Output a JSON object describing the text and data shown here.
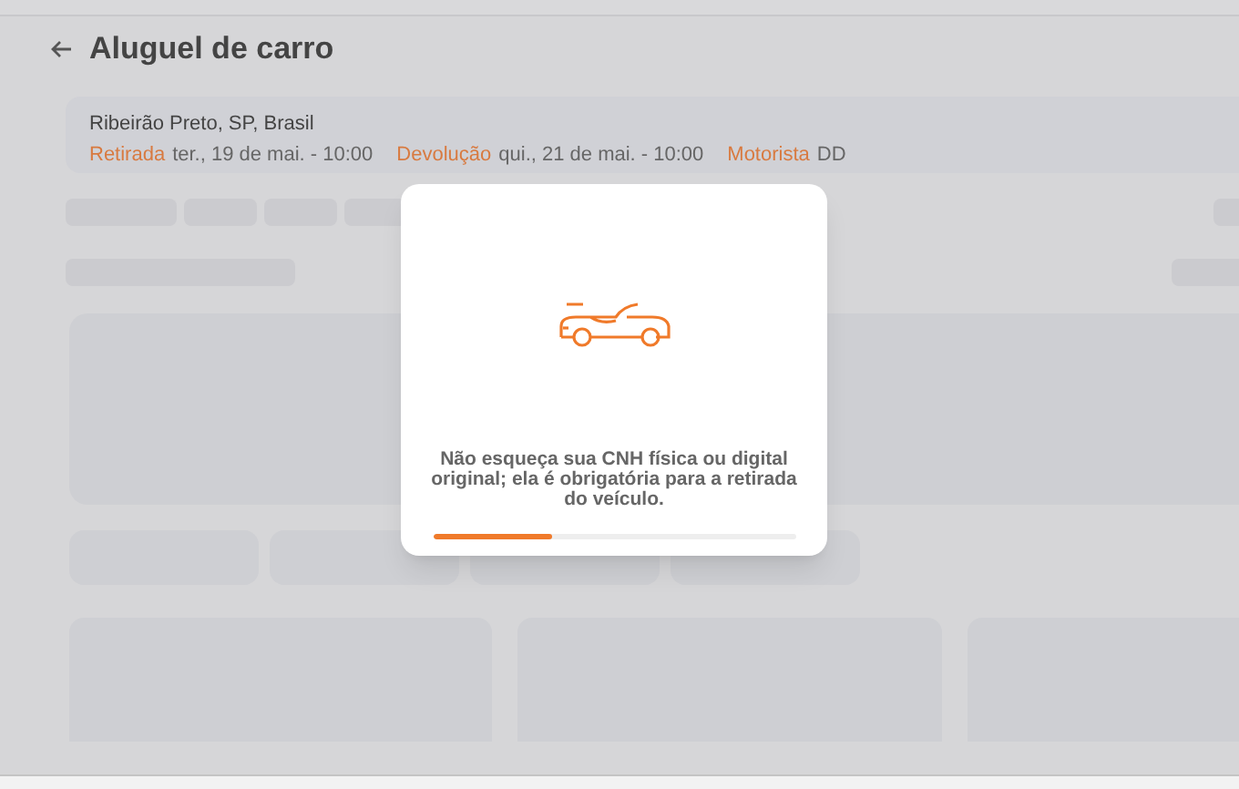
{
  "header": {
    "title": "Aluguel de carro"
  },
  "trip": {
    "location": "Ribeirão Preto, SP, Brasil",
    "fields": [
      {
        "label": "Retirada",
        "value": "ter., 19 de mai. - 10:00"
      },
      {
        "label": "Devolução",
        "value": "qui., 21 de mai. - 10:00"
      },
      {
        "label": "Motorista",
        "value": "DD"
      }
    ]
  },
  "loading_dialog": {
    "message": "Não esqueça sua CNH física ou digital original; ela é obrigatória para a retirada do veículo.",
    "level": 0.33
  }
}
